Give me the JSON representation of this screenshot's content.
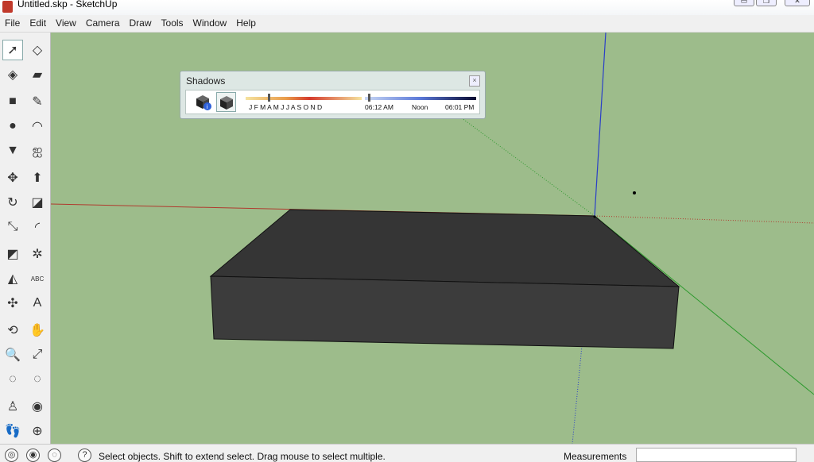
{
  "window": {
    "title": "Untitled.skp - SketchUp"
  },
  "menu": [
    "File",
    "Edit",
    "View",
    "Camera",
    "Draw",
    "Tools",
    "Window",
    "Help"
  ],
  "tools": [
    {
      "name": "select-tool",
      "glyph": "➚"
    },
    {
      "name": "make-component-tool",
      "glyph": "◇"
    },
    {
      "name": "paint-bucket-tool",
      "glyph": "◈"
    },
    {
      "name": "eraser-tool",
      "glyph": "▰"
    },
    {
      "name": "rectangle-tool",
      "glyph": "■"
    },
    {
      "name": "line-tool",
      "glyph": "✎"
    },
    {
      "name": "circle-tool",
      "glyph": "●"
    },
    {
      "name": "arc-tool",
      "glyph": "◠"
    },
    {
      "name": "polygon-tool",
      "glyph": "▼"
    },
    {
      "name": "freehand-tool",
      "glyph": "ஐ"
    },
    {
      "name": "move-tool",
      "glyph": "✥"
    },
    {
      "name": "push-pull-tool",
      "glyph": "⬆"
    },
    {
      "name": "rotate-tool",
      "glyph": "↻"
    },
    {
      "name": "follow-me-tool",
      "glyph": "◪"
    },
    {
      "name": "scale-tool",
      "glyph": "⤡"
    },
    {
      "name": "offset-tool",
      "glyph": "◜"
    },
    {
      "name": "tape-measure-tool",
      "glyph": "◩"
    },
    {
      "name": "dimension-tool",
      "glyph": "✲"
    },
    {
      "name": "protractor-tool",
      "glyph": "◭"
    },
    {
      "name": "text-tool",
      "glyph": "ABC"
    },
    {
      "name": "axes-tool",
      "glyph": "✣"
    },
    {
      "name": "3d-text-tool",
      "glyph": "A"
    },
    {
      "name": "orbit-tool",
      "glyph": "⟲"
    },
    {
      "name": "pan-tool",
      "glyph": "✋"
    },
    {
      "name": "zoom-tool",
      "glyph": "🔍"
    },
    {
      "name": "zoom-extents-tool",
      "glyph": "⤢"
    },
    {
      "name": "previous-view-tool",
      "glyph": "◌"
    },
    {
      "name": "next-view-tool",
      "glyph": "◌"
    },
    {
      "name": "position-camera-tool",
      "glyph": "♙"
    },
    {
      "name": "look-around-tool",
      "glyph": "◉"
    },
    {
      "name": "walk-tool",
      "glyph": "👣"
    },
    {
      "name": "section-plane-tool",
      "glyph": "⊕"
    }
  ],
  "shadows": {
    "title": "Shadows",
    "close": "×",
    "months": "J F M A M J J A S O N D",
    "time_start": "06:12 AM",
    "time_noon": "Noon",
    "time_end": "06:01 PM"
  },
  "status": {
    "help_glyph": "?",
    "message": "Select objects. Shift to extend select. Drag mouse to select multiple.",
    "measurements_label": "Measurements",
    "measurements_value": ""
  },
  "colors": {
    "viewport": "#9dbc8b",
    "block_face": "#3a3a3a",
    "axis_red": "#b03a2e",
    "axis_green": "#2f9a2f",
    "axis_blue": "#2a3fc8"
  }
}
